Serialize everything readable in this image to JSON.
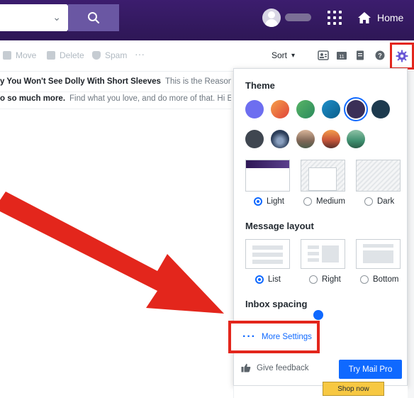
{
  "header": {
    "search_dropdown_icon": "chevron-down-icon",
    "search_button_icon": "search-icon",
    "home_label": "Home",
    "colors": {
      "bar": "#3c1d6e",
      "search_button": "#6a57a3"
    }
  },
  "toolbar": {
    "move_label": "Move",
    "delete_label": "Delete",
    "spam_label": "Spam",
    "more_label": "···",
    "sort_label": "Sort"
  },
  "messages": [
    {
      "subject": "y You Won't See Dolly With Short Sleeves",
      "snippet": "This is the Reason Wh..."
    },
    {
      "subject": "o so much more.",
      "snippet": "Find what you love, and do more of that. Hi Em..."
    }
  ],
  "settings_panel": {
    "theme_heading": "Theme",
    "theme_swatches": [
      "#6d6ef0",
      "#f26b3a",
      "#3fa55f",
      "#0f7fb5",
      "#3b2f57",
      "#1d3a4e",
      "#3f4650",
      "#2c3e5a",
      "#9a7a66",
      "#c8563a",
      "#3f8f6f"
    ],
    "selected_theme_index": 4,
    "appearance_options": [
      "Light",
      "Medium",
      "Dark"
    ],
    "appearance_selected": "Light",
    "layout_heading": "Message layout",
    "layout_options": [
      "List",
      "Right",
      "Bottom"
    ],
    "layout_selected": "List",
    "spacing_heading": "Inbox spacing",
    "more_settings_label": "More Settings",
    "feedback_label": "Give feedback",
    "try_pro_label": "Try Mail Pro",
    "shop_now_label": "Shop now",
    "accent_color": "#0f69ff",
    "highlight_color": "#e3261c"
  }
}
